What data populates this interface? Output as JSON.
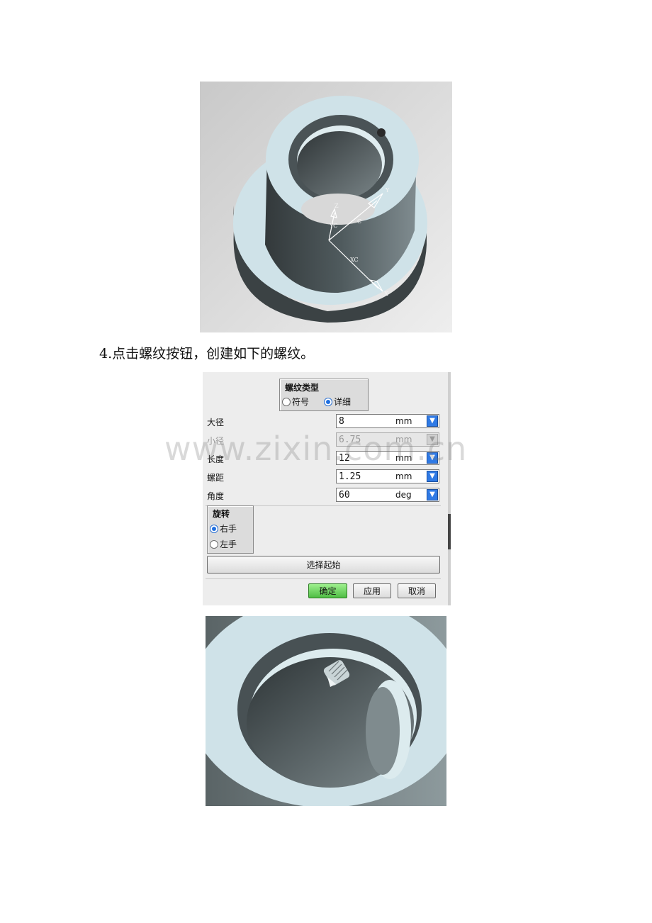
{
  "caption": "4.点击螺纹按钮，创建如下的螺纹。",
  "figure1": {
    "axis_labels": [
      "Z",
      "YC",
      "C",
      "XC",
      "X",
      "Y"
    ]
  },
  "dialog": {
    "thread_type": {
      "title": "螺纹类型",
      "options": [
        "符号",
        "详细"
      ],
      "selected": "详细"
    },
    "rows": [
      {
        "label": "大径",
        "value": "8",
        "unit": "mm",
        "enabled": true
      },
      {
        "label": "小径",
        "value": "6.75",
        "unit": "mm",
        "enabled": false
      },
      {
        "label": "长度",
        "value": "12",
        "unit": "mm",
        "enabled": true
      },
      {
        "label": "螺距",
        "value": "1.25",
        "unit": "mm",
        "enabled": true
      },
      {
        "label": "角度",
        "value": "60",
        "unit": "deg",
        "enabled": true
      }
    ],
    "rotation": {
      "title": "旋转",
      "options": [
        "右手",
        "左手"
      ],
      "selected": "右手"
    },
    "select_start_label": "选择起始",
    "buttons": {
      "ok": "确定",
      "apply": "应用",
      "cancel": "取消"
    }
  },
  "watermark": "www.zixin.com.cn"
}
